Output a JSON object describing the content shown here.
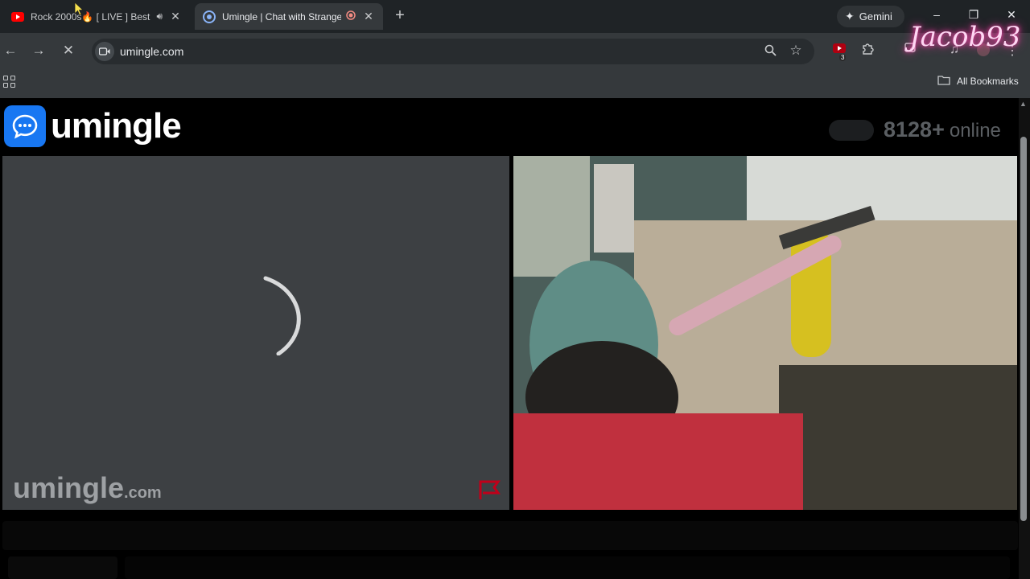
{
  "browser": {
    "tabs": [
      {
        "title": "Rock 2000s🔥 [ LIVE ] Best",
        "state": "inactive",
        "audio": true
      },
      {
        "title": "Umingle | Chat with Strangers",
        "state": "active",
        "recording": true
      }
    ],
    "gemini_label": "Gemini",
    "url": "umingle.com",
    "extensions_badge": "3",
    "bookmarks_label": "All Bookmarks"
  },
  "page": {
    "brand": "umingle",
    "online_count": "8128+",
    "online_label": "online",
    "watermark_main": "umingle",
    "watermark_tld": ".com",
    "stranger_state": "loading"
  },
  "stream_overlay": {
    "name": "Jacob93"
  },
  "colors": {
    "brand_blue": "#1877f2",
    "tab_bg": "#1f2326",
    "toolbar_bg": "#35393c",
    "pane_gray": "#3d4043",
    "report_red": "#c0001a"
  },
  "icons": [
    "youtube-icon",
    "speaker-icon",
    "close-icon",
    "chat-icon",
    "record-icon",
    "plus-icon",
    "sparkle-icon",
    "back-icon",
    "forward-icon",
    "stop-icon",
    "zoom-icon",
    "star-icon",
    "puzzle-icon",
    "apps-icon",
    "folder-icon",
    "flag-icon"
  ]
}
